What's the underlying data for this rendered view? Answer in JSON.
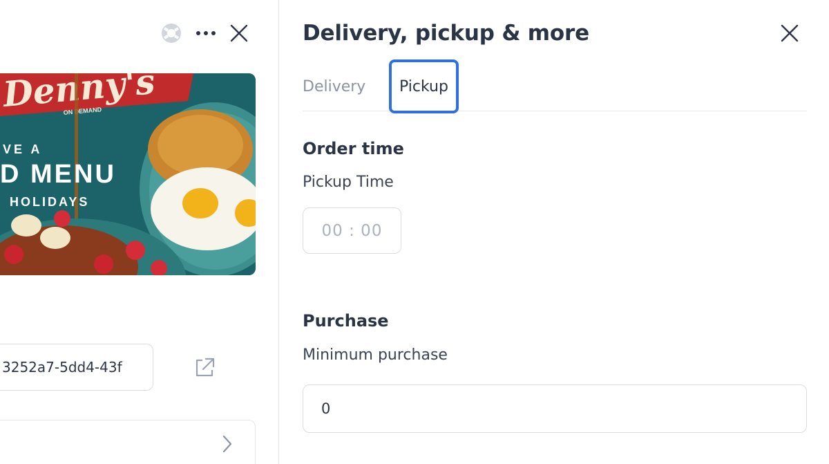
{
  "left_panel": {
    "icons": {
      "help": "lifebuoy-icon",
      "more": "more-horizontal-icon",
      "close": "close-icon"
    },
    "promo": {
      "brand": "Denny's",
      "tagline": "ON DEMAND",
      "line1": "VE A",
      "line2": "D MENU",
      "line3": "HOLIDAYS"
    },
    "id_field": {
      "value": "3252a7-5dd4-43f"
    },
    "external_link_icon": "external-link-icon",
    "nav_row_chevron": "chevron-right-icon"
  },
  "right_panel": {
    "title": "Delivery, pickup & more",
    "close_icon": "close-icon",
    "tabs": [
      {
        "label": "Delivery",
        "active": false
      },
      {
        "label": "Pickup",
        "active": true
      }
    ],
    "order_time": {
      "title": "Order time",
      "pickup_time_label": "Pickup Time",
      "pickup_time_placeholder": "00 : 00"
    },
    "purchase": {
      "title": "Purchase",
      "minimum_label": "Minimum purchase",
      "minimum_value": "0"
    }
  },
  "colors": {
    "text": "#2b3444",
    "muted": "#8a93a0",
    "active_tab_outline": "#2f6fe0",
    "border": "#d8dde3"
  }
}
